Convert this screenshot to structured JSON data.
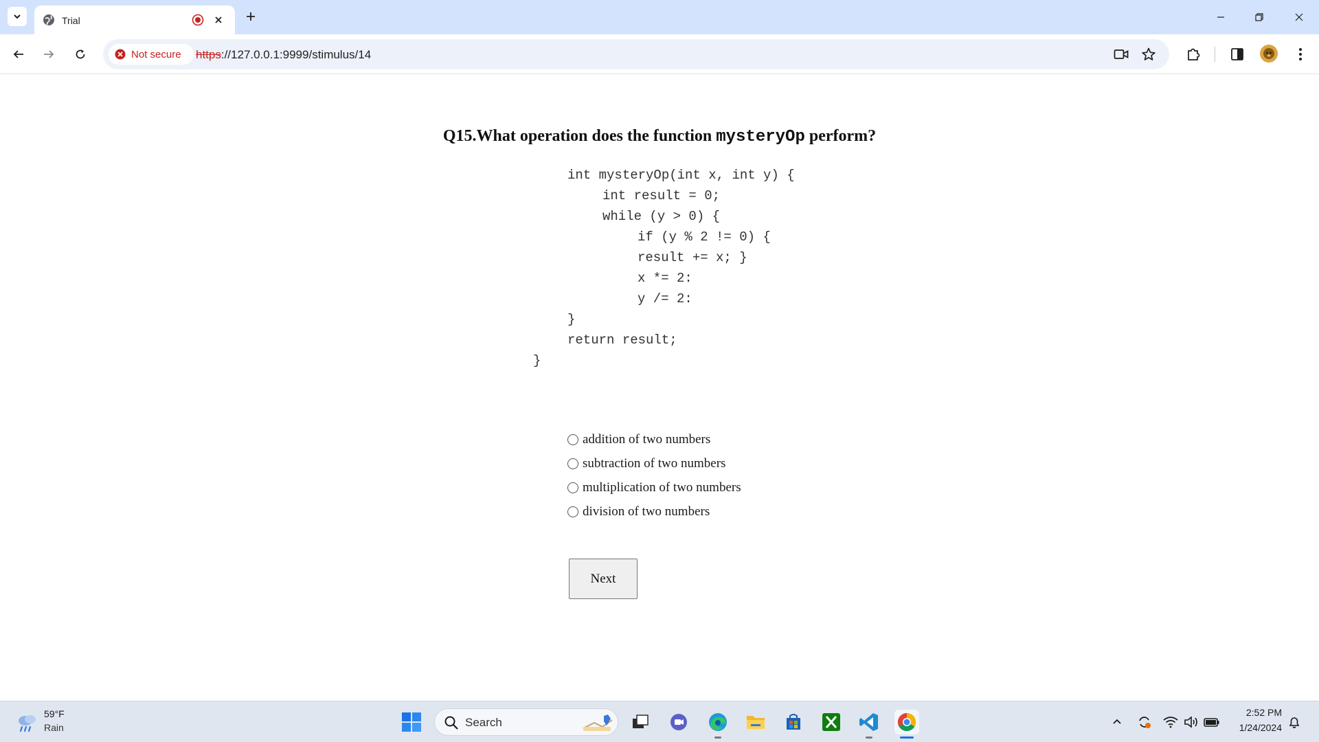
{
  "browser": {
    "tab_title": "Trial",
    "security_label": "Not secure",
    "url_scheme": "https",
    "url_rest": "://127.0.0.1:9999/stimulus/14"
  },
  "question": {
    "prefix": "Q15.What operation does the function ",
    "code_word": "mysteryOp",
    "suffix": " perform?"
  },
  "code_lines": [
    "int mysteryOp(int x, int y) {",
    "int result = 0;",
    "while (y > 0) {",
    "if (y % 2 != 0) {",
    "result += x; }",
    "x *= 2:",
    "y /= 2:",
    "}",
    "return result;",
    "}"
  ],
  "options": [
    "addition of two numbers",
    "subtraction of two numbers",
    "multiplication of two numbers",
    "division of two numbers"
  ],
  "next_label": "Next",
  "taskbar": {
    "weather_temp": "59°F",
    "weather_condition": "Rain",
    "search_placeholder": "Search",
    "time": "2:52 PM",
    "date": "1/24/2024",
    "apps": [
      "file-explorer-app",
      "meet-app",
      "edge-app",
      "folder-app",
      "store-app",
      "xbox-app",
      "vscode-app",
      "chrome-app"
    ]
  },
  "colors": {
    "tab_strip": "#d3e3fd",
    "not_secure_red": "#c5221f",
    "omnibox": "#edf2fa",
    "taskbar": "#dfe6ef"
  }
}
